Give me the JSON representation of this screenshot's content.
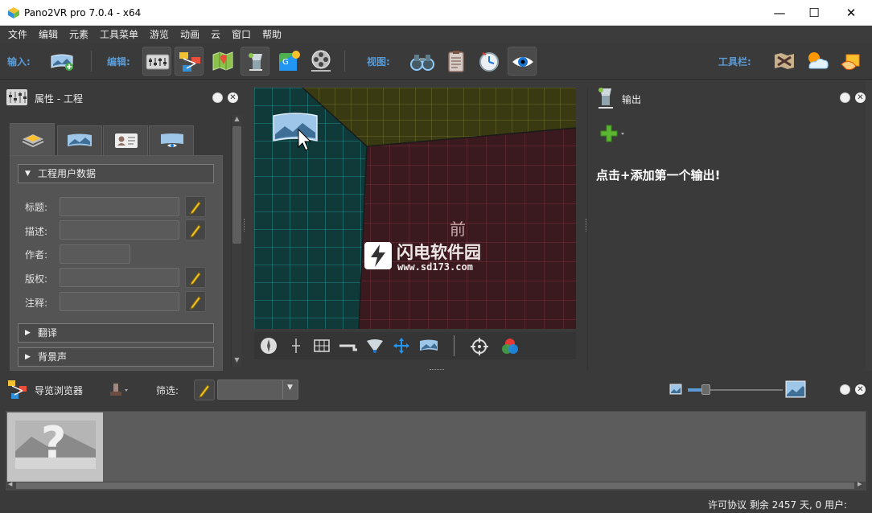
{
  "window": {
    "title": "Pano2VR pro 7.0.4 - x64",
    "minimize": "—",
    "maximize": "☐",
    "close": "✕"
  },
  "menu": [
    "文件",
    "编辑",
    "元素",
    "工具菜单",
    "游览",
    "动画",
    "云",
    "窗口",
    "帮助"
  ],
  "toolbar": {
    "input_label": "输入:",
    "edit_label": "编辑:",
    "view_label": "视图:",
    "toolbars_label": "工具栏:",
    "edit_icons": [
      "properties-icon",
      "tour-map-icon",
      "map-icon",
      "skin-icon",
      "google-street-view-icon",
      "film-icon"
    ],
    "view_icons": [
      "binoculars-icon",
      "clipboard-icon",
      "clock-icon",
      "eye-icon"
    ],
    "toolbars_icons": [
      "map-tool-icon",
      "weather-icon",
      "hand-icon"
    ]
  },
  "properties": {
    "title": "属性 - 工程",
    "section_user_data": "工程用户数据",
    "labels": {
      "title": "标题:",
      "desc": "描述:",
      "author": "作者:",
      "copyright": "版权:",
      "comment": "注释:"
    },
    "section_translate": "翻译",
    "section_bg_sound": "背景声"
  },
  "viewer": {
    "center_text": "前",
    "watermark_title": "闪电软件园",
    "watermark_url": "www.sd173.com"
  },
  "output": {
    "title": "输出",
    "hint": "点击+添加第一个输出!"
  },
  "browser": {
    "title": "导览浏览器",
    "filter_label": "筛选:",
    "filter_value": "",
    "thumb_text": "?"
  },
  "status": {
    "text": "许可协议 剩余 2457 天, 0 用户:"
  },
  "colors": {
    "accent_label": "#5b9bd5",
    "background": "#3a3a3a",
    "viewer_left": "#10393a",
    "viewer_right": "#3a1a1e",
    "viewer_top": "#3a3a12"
  }
}
